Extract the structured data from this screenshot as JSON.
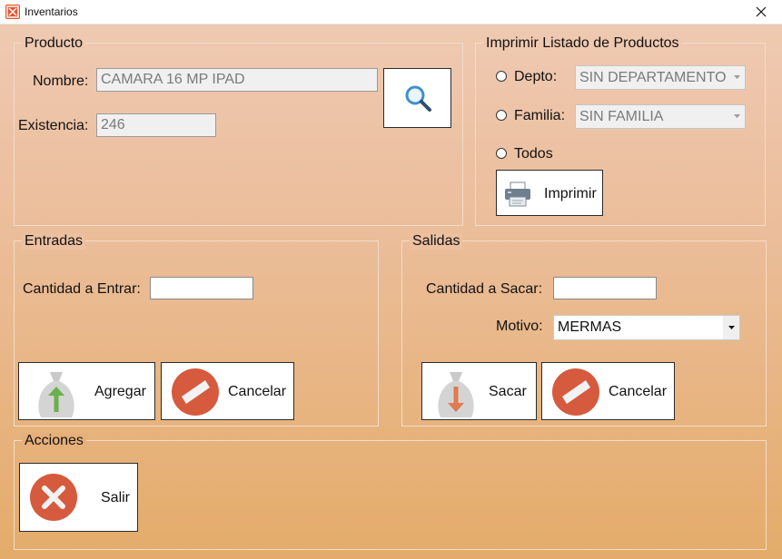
{
  "window": {
    "title": "Inventarios"
  },
  "producto": {
    "label": "Producto",
    "nombre_label": "Nombre:",
    "nombre_value": "CAMARA 16 MP IPAD",
    "existencia_label": "Existencia:",
    "existencia_value": "246"
  },
  "imprimir": {
    "label": "Imprimir Listado de Productos",
    "depto_label": "Depto:",
    "depto_value": "SIN DEPARTAMENTO",
    "familia_label": "Familia:",
    "familia_value": "SIN FAMILIA",
    "todos_label": "Todos",
    "button_label": "Imprimir"
  },
  "entradas": {
    "label": "Entradas",
    "cantidad_label": "Cantidad a Entrar:",
    "cantidad_value": "",
    "agregar_label": "Agregar",
    "cancelar_label": "Cancelar"
  },
  "salidas": {
    "label": "Salidas",
    "cantidad_label": "Cantidad a Sacar:",
    "cantidad_value": "",
    "motivo_label": "Motivo:",
    "motivo_value": "MERMAS",
    "sacar_label": "Sacar",
    "cancelar_label": "Cancelar"
  },
  "acciones": {
    "label": "Acciones",
    "salir_label": "Salir"
  },
  "icons": {
    "app": "app-icon",
    "close": "close-icon",
    "search": "search-icon",
    "printer": "printer-icon",
    "bag_in": "bag-arrow-up-icon",
    "bag_out": "bag-arrow-down-icon",
    "cancel": "cancel-icon",
    "exit": "exit-x-icon"
  },
  "colors": {
    "accent_red": "#d65a3e",
    "arrow_green": "#6ab04c",
    "bag_gray": "#c9c9c9"
  }
}
